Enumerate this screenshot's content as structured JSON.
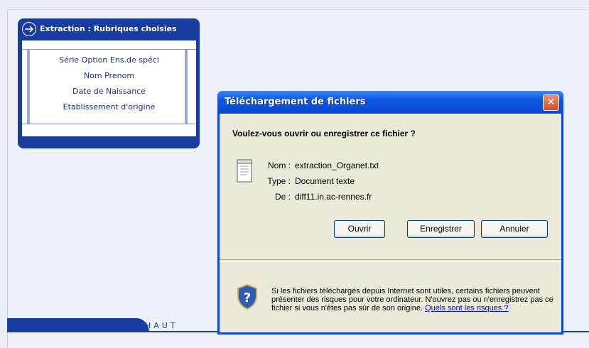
{
  "panel": {
    "title": "Extraction : Rubriques choisies",
    "items": [
      "Série Option Ens.de spéci",
      "Nom Prenom",
      "Date de Naissance",
      "Etablissement d'origine"
    ]
  },
  "footer": {
    "haut_label": "HAUT"
  },
  "dialog": {
    "title": "Téléchargement de fichiers",
    "question": "Voulez-vous ouvrir ou enregistrer ce fichier ?",
    "name_label": "Nom :",
    "name_value": "extraction_Organet.txt",
    "type_label": "Type :",
    "type_value": "Document texte",
    "from_label": "De :",
    "from_value": "diff11.in.ac-rennes.fr",
    "buttons": {
      "open": "Ouvrir",
      "save": "Enregistrer",
      "cancel": "Annuler"
    },
    "warning_text": "Si les fichiers téléchargés depuis Internet sont utiles, certains fichiers peuvent présenter des risques pour votre ordinateur. N'ouvrez pas ou n'enregistrez pas ce fichier si vous n'êtes pas sûr de son origine.",
    "warning_link": "Quels sont les risques ?"
  },
  "colors": {
    "panel_blue": "#193d9f",
    "xp_title_blue": "#0b56e1",
    "dialog_bg": "#ece9d8",
    "close_red": "#d2502c"
  },
  "icons": {
    "panel_arrow": "arrow-right-icon",
    "file": "text-file-icon",
    "shield": "security-shield-icon",
    "close": "close-icon"
  }
}
